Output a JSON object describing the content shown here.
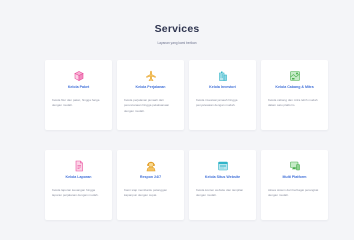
{
  "header": {
    "title": "Services",
    "subtitle": "Layanan yang kami berikan"
  },
  "cards": [
    {
      "title": "Kelola Paket",
      "desc": "Kelola fitur dan paket, hingga harga dengan mudah.",
      "icon": "box-icon",
      "color": "#e94e9d"
    },
    {
      "title": "Kelola Perjalanan",
      "desc": "Kelola perjalanan jamaah dari perencanaan hingga pelaksanaan dengan mudah.",
      "icon": "plane-icon",
      "color": "#f0a52c"
    },
    {
      "title": "Kelola Investori",
      "desc": "Kelola investasi jamaah hingga penyelesaian dengan mudah.",
      "icon": "building-icon",
      "color": "#30b4c8"
    },
    {
      "title": "Kelola Cabang & Mitra",
      "desc": "Kelola cabang dan mitra lebih mudah dalam satu platform.",
      "icon": "map-icon",
      "color": "#4caf50"
    },
    {
      "title": "Kelola Laporan",
      "desc": "Kelola laporan keuangan hingga laporan perjalanan dengan mudah.",
      "icon": "report-icon",
      "color": "#e94e9d"
    },
    {
      "title": "Respon 24/7",
      "desc": "Kami siap membantu pelanggan kapanpun dengan cepat.",
      "icon": "support-icon",
      "color": "#f0a52c"
    },
    {
      "title": "Kelola Situs Website",
      "desc": "Kelola konten website dan tampilan dengan mudah.",
      "icon": "browser-icon",
      "color": "#30b4c8"
    },
    {
      "title": "Multi Platform",
      "desc": "Akses sistem dari berbagai perangkat dengan mudah.",
      "icon": "devices-icon",
      "color": "#4caf50"
    }
  ]
}
